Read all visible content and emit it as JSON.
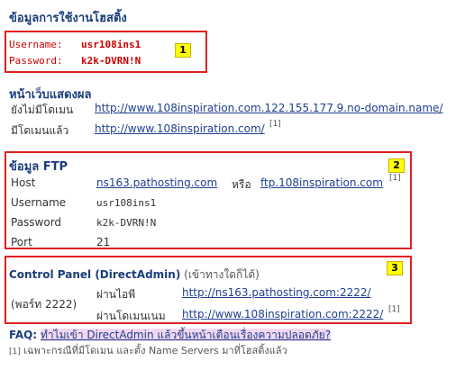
{
  "page_title": "ข้อมูลการใช้งานโฮสติ้ง",
  "credentials": {
    "username_label": "Username:",
    "username_value": "usr108ins1",
    "password_label": "Password:",
    "password_value": "k2k-DVRN!N",
    "badge": "1"
  },
  "display_section": {
    "heading": "หน้าเว็บแสดงผล",
    "rows": [
      {
        "label": "ยังไม่มีโดเมน",
        "url": "http://www.108inspiration.com.122.155.177.9.no-domain.name/"
      },
      {
        "label": "มีโดเมนแล้ว",
        "url": "http://www.108inspiration.com/",
        "note": "[1]"
      }
    ]
  },
  "ftp": {
    "heading": "ข้อมูล FTP",
    "badge": "2",
    "host_label": "Host",
    "host_primary": "ns163.pathosting.com",
    "host_or": "หรือ",
    "host_alt": "ftp.108inspiration.com",
    "host_note": "[1]",
    "username_label": "Username",
    "username_value": "usr108ins1",
    "password_label": "Password",
    "password_value": "k2k-DVRN!N",
    "port_label": "Port",
    "port_value": "21"
  },
  "control_panel": {
    "heading": "Control Panel (DirectAdmin)",
    "heading_note": "(เข้าทางใดก็ได้)",
    "badge": "3",
    "port_label": "(พอร์ท 2222)",
    "via_ip_label": "ผ่านไอพี",
    "via_ip_url": "http://ns163.pathosting.com:2222/",
    "via_domain_label": "ผ่านโดเมนเนม",
    "via_domain_url": "http://www.108inspiration.com:2222/",
    "via_domain_note": "[1]"
  },
  "faq": {
    "label": "FAQ:",
    "link_text": "ทำไมเข้า DirectAdmin แล้วขึ้นหน้าเตือนเรื่องความปลอดภัย?"
  },
  "footnote": {
    "marker": "[1]",
    "text": "เฉพาะกรณีที่มีโดเมน และตั้ง Name Servers มาที่โฮสติ้งแล้ว"
  },
  "colors": {
    "heading": "#1a3d7c",
    "link": "#1f3f8f",
    "highlight_box": "#e02020",
    "badge": "#ffff00",
    "credential_text": "#cc0000"
  }
}
